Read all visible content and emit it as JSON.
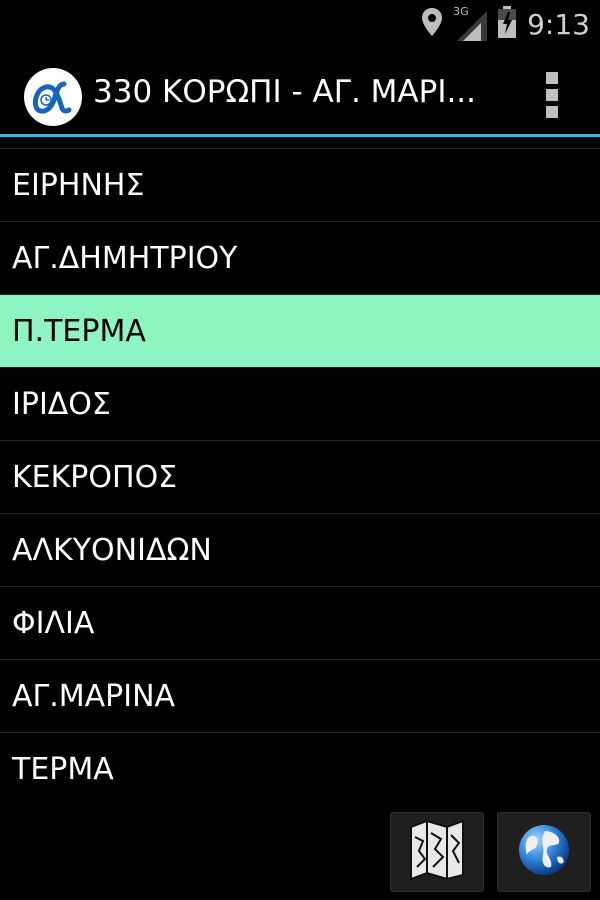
{
  "status_bar": {
    "time": "9:13",
    "network": "3G",
    "icons": [
      "location-icon",
      "signal-icon",
      "battery-icon"
    ]
  },
  "action_bar": {
    "title": "330 ΚΟΡΩΠΙ - ΑΓ. ΜΑΡΙ...",
    "logo_icon": "alpha-logo-icon",
    "menu_icon": "overflow-menu-icon"
  },
  "stops": [
    {
      "label": "ΕΙΡΗΝΗΣ",
      "selected": false
    },
    {
      "label": "ΑΓ.ΔΗΜΗΤΡΙΟΥ",
      "selected": false
    },
    {
      "label": "Π.ΤΕΡΜΑ",
      "selected": true
    },
    {
      "label": "ΙΡΙΔΟΣ",
      "selected": false
    },
    {
      "label": "ΚΕΚΡΟΠΟΣ",
      "selected": false
    },
    {
      "label": "ΑΛΚΥΟΝΙΔΩΝ",
      "selected": false
    },
    {
      "label": "ΦΙΛΙΑ",
      "selected": false
    },
    {
      "label": "ΑΓ.ΜΑΡΙΝΑ",
      "selected": false
    },
    {
      "label": "ΤΕΡΜΑ",
      "selected": false
    }
  ],
  "buttons": {
    "map_icon": "map-icon",
    "globe_icon": "globe-icon"
  },
  "colors": {
    "accent": "#33b5e5",
    "selected_row": "#8ef4c2",
    "background": "#000000"
  }
}
